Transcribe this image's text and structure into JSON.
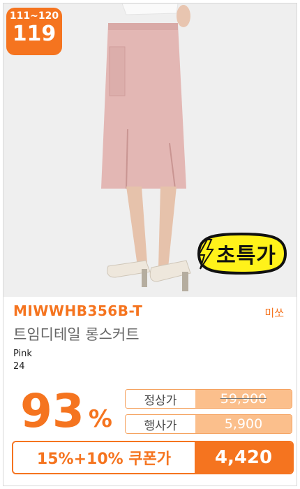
{
  "rank": {
    "range": "111~120",
    "number": "119"
  },
  "sticker": {
    "label": "초특가"
  },
  "product": {
    "code": "MIWWHB356B-T",
    "brand": "미쏘",
    "name": "트임디테일 롱스커트",
    "color": "Pink",
    "size": "24"
  },
  "discount": {
    "value": "93",
    "unit": "%"
  },
  "prices": {
    "regular_label": "정상가",
    "regular_value": "59,900",
    "event_label": "행사가",
    "event_value": "5,900"
  },
  "coupon": {
    "label": "15%+10% 쿠폰가",
    "value": "4,420"
  },
  "colors": {
    "accent": "#f5741f",
    "light_accent": "#fbbf8c",
    "skirt": "#e3b7b4"
  }
}
